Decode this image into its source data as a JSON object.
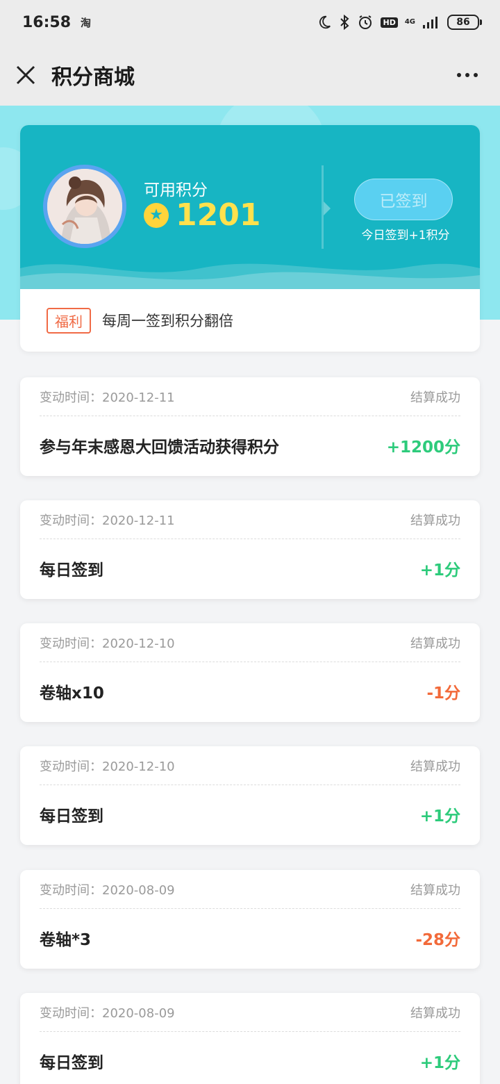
{
  "status_bar": {
    "time": "16:58",
    "app_icon_text": "淘",
    "network": "4G",
    "hd": "HD",
    "battery": "86"
  },
  "nav": {
    "title": "积分商城"
  },
  "points": {
    "label": "可用积分",
    "value": "1201",
    "signin_button": "已签到",
    "signin_note": "今日签到+1积分",
    "welfare_tag": "福利",
    "welfare_text": "每周一签到积分翻倍"
  },
  "colors": {
    "accent_teal": "#17b5c3",
    "positive": "#2dcb7b",
    "negative": "#f26a3a",
    "welfare": "#f06a45"
  },
  "records": [
    {
      "time": "变动时间：2020-12-11",
      "status": "结算成功",
      "title": "参与年末感恩大回馈活动获得积分",
      "amount": "+1200分",
      "sign": "pos"
    },
    {
      "time": "变动时间：2020-12-11",
      "status": "结算成功",
      "title": "每日签到",
      "amount": "+1分",
      "sign": "pos"
    },
    {
      "time": "变动时间：2020-12-10",
      "status": "结算成功",
      "title": "卷轴x10",
      "amount": "-1分",
      "sign": "neg"
    },
    {
      "time": "变动时间：2020-12-10",
      "status": "结算成功",
      "title": "每日签到",
      "amount": "+1分",
      "sign": "pos"
    },
    {
      "time": "变动时间：2020-08-09",
      "status": "结算成功",
      "title": "卷轴*3",
      "amount": "-28分",
      "sign": "neg"
    },
    {
      "time": "变动时间：2020-08-09",
      "status": "结算成功",
      "title": "每日签到",
      "amount": "+1分",
      "sign": "pos"
    }
  ]
}
